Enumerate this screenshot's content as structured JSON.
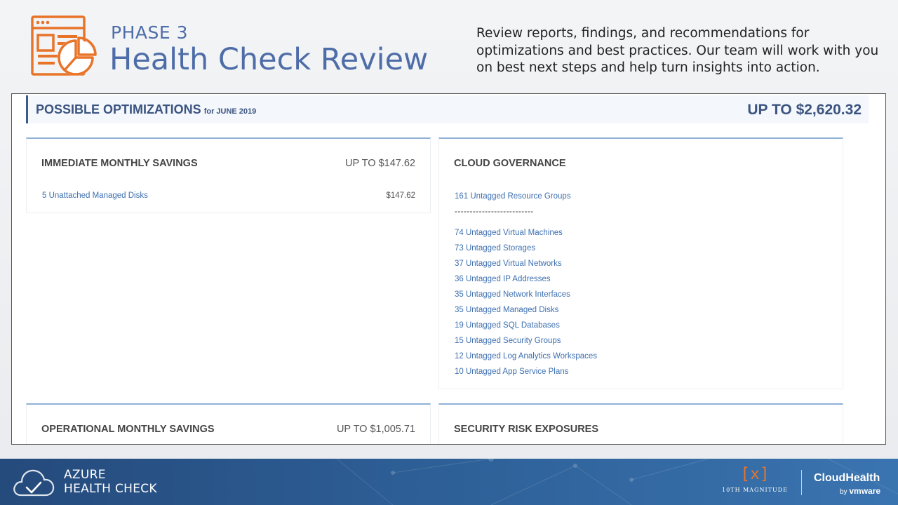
{
  "header": {
    "phase": "PHASE 3",
    "title": "Health Check Review",
    "description": "Review reports, findings, and recommendations for optimizations and best practices. Our team will work with you on best next steps and help turn insights into action.",
    "icon": "report-chart-icon"
  },
  "report": {
    "banner": {
      "title": "POSSIBLE OPTIMIZATIONS",
      "subtitle": "for JUNE 2019",
      "total": "UP TO $2,620.32"
    },
    "immediate": {
      "title": "IMMEDIATE MONTHLY SAVINGS",
      "total": "UP TO $147.62",
      "items": [
        {
          "label": "5 Unattached Managed Disks",
          "amount": "$147.62"
        }
      ]
    },
    "governance": {
      "title": "CLOUD GOVERNANCE",
      "summary": "161 Untagged Resource Groups",
      "separator": "--------------------------",
      "items": [
        "74 Untagged Virtual Machines",
        "73 Untagged Storages",
        "37 Untagged Virtual Networks",
        "36 Untagged IP Addresses",
        "35 Untagged Network Interfaces",
        "35 Untagged Managed Disks",
        "19 Untagged SQL Databases",
        "15 Untagged Security Groups",
        "12 Untagged Log Analytics Workspaces",
        "10 Untagged App Service Plans"
      ]
    },
    "operational": {
      "title": "OPERATIONAL MONTHLY SAVINGS",
      "total": "UP TO $1,005.71"
    },
    "security": {
      "title": "SECURITY RISK EXPOSURES"
    }
  },
  "footer": {
    "title_line1": "AZURE",
    "title_line2": "HEALTH CHECK",
    "partner_logo": "[x]",
    "partner_name": "10TH MAGNITUDE",
    "vendor_name": "CloudHealth",
    "vendor_by": "by",
    "vendor_parent": "vmware",
    "icon": "cloud-check-icon"
  },
  "colors": {
    "accent": "#4e6da8",
    "icon_orange": "#e8742a",
    "link": "#3d6fb0",
    "footer_blue": "#2d5e95"
  }
}
